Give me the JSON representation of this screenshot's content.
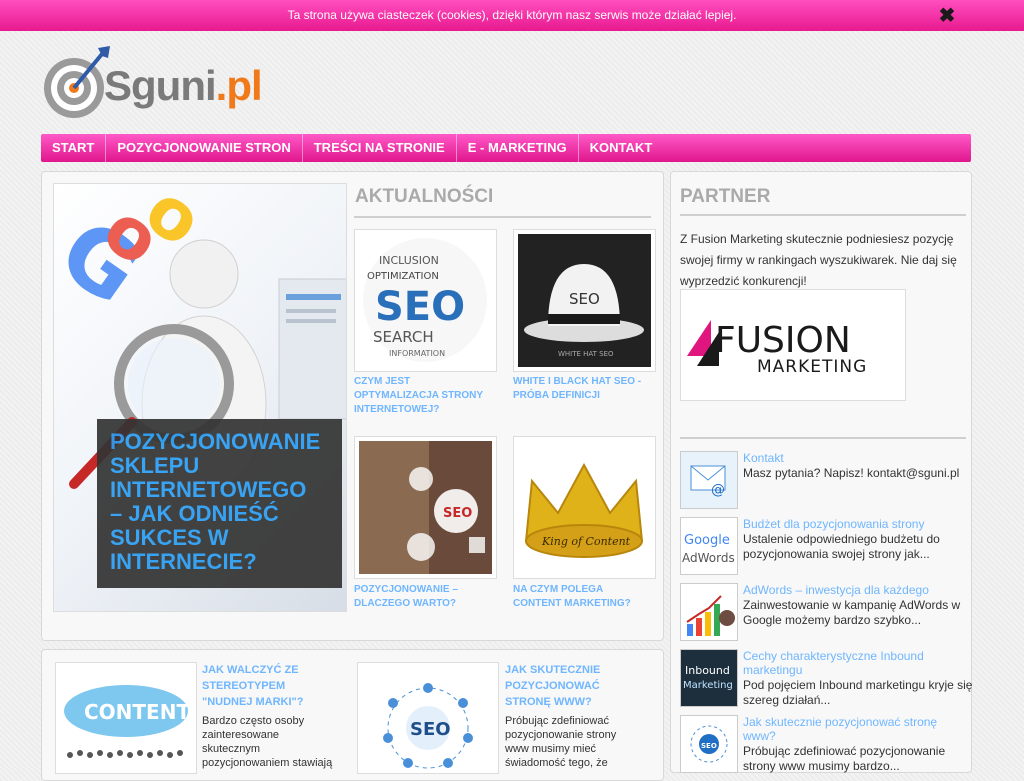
{
  "cookie": {
    "text": "Ta strona używa ciasteczek (cookies), dzięki którym nasz serwis może działać lepiej.",
    "close_icon": "close-icon"
  },
  "logo": {
    "text_main": "Sguni",
    "text_dot": ".pl",
    "colors": {
      "ring": "#9a9a9a",
      "arrow": "#2e5aa8",
      "accent": "#f07a1a"
    }
  },
  "nav": {
    "items": [
      {
        "label": "START"
      },
      {
        "label": "POZYCJONOWANIE STRON"
      },
      {
        "label": "TREŚCI NA STRONIE"
      },
      {
        "label": "E - MARKETING"
      },
      {
        "label": "KONTAKT"
      }
    ]
  },
  "hero": {
    "title": "POZYCJONOWANIE\nSKLEPU\nINTERNETOWEGO\n– JAK ODNIEŚĆ\nSUKCES W\nINTERNECIE?"
  },
  "news": {
    "title": "AKTUALNOŚCI",
    "items": [
      {
        "title": "CZYM JEST\nOPTYMALIZACJA STRONY\nINTERNETOWEJ?"
      },
      {
        "title": "WHITE I BLACK HAT SEO -\nPRÓBA DEFINICJI"
      },
      {
        "title": "POZYCJONOWANIE –\nDLACZEGO WARTO?"
      },
      {
        "title": "NA CZYM POLEGA\nCONTENT MARKETING?"
      }
    ]
  },
  "partner": {
    "title": "PARTNER",
    "text": "Z Fusion Marketing skutecznie podniesiesz pozycję swojej firmy w rankingach wyszukiwarek. Nie daj się wyprzedzić konkurencji!",
    "logo_top": "FUSION",
    "logo_bottom": "MARKETING",
    "brand_color": "#e0167e"
  },
  "sidebar": {
    "items": [
      {
        "title": "Kontakt",
        "desc": "Masz pytania? Napisz! kontakt@sguni.pl"
      },
      {
        "title": "Budżet dla pozycjonowania strony",
        "desc": "Ustalenie odpowiedniego budżetu do pozycjonowania swojej strony jak..."
      },
      {
        "title": "AdWords – inwestycja dla każdego",
        "desc": "Zainwestowanie w kampanię AdWords w Google możemy bardzo szybko..."
      },
      {
        "title": "Cechy charakterystyczne Inbound marketingu",
        "desc": "Pod pojęciem Inbound marketingu kryje się szereg działań..."
      },
      {
        "title": "Jak skutecznie pozycjonować stronę www?",
        "desc": "Próbując zdefiniować pozycjonowanie strony www musimy bardzo..."
      }
    ]
  },
  "bottom": {
    "items": [
      {
        "title": "JAK WALCZYĆ ZE\nSTEREOTYPEM\n\"NUDNEJ MARKI\"?",
        "desc": "Bardzo często osoby\nzainteresowane\nskutecznym\npozycjonowaniem stawiają",
        "thumb_text": "CONTENT"
      },
      {
        "title": "JAK SKUTECZNIE\nPOZYCJONOWAĆ\nSTRONĘ WWW?",
        "desc": "Próbując zdefiniować\npozycjonowanie strony\nwww musimy mieć\nświadomość tego, że",
        "thumb_text": "SEO"
      }
    ]
  },
  "side_thumb_texts": {
    "adwords_1": "Google",
    "adwords_2": "AdWords",
    "inbound_1": "Inbound",
    "inbound_2": "Marketing",
    "seo": "SEO"
  },
  "news_thumb_texts": {
    "seo_cloud": "SEO",
    "seo_hat": "SEO",
    "seo_chess": "SEO",
    "crown": "King of Content",
    "hat_caption": "WHITE HAT SEO"
  }
}
